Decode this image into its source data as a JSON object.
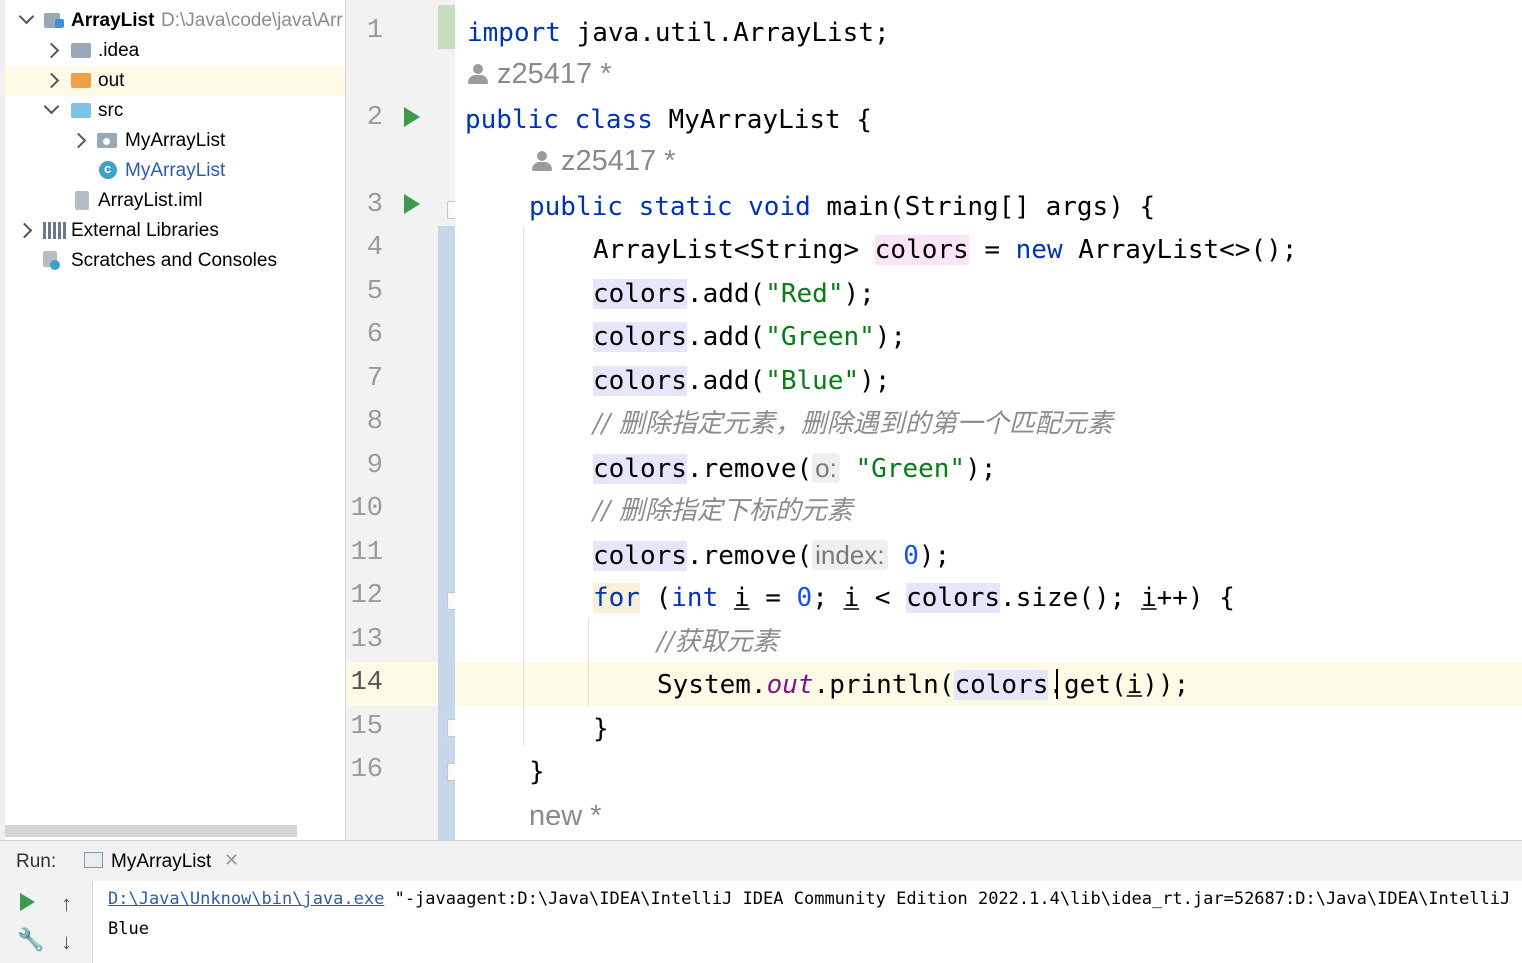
{
  "project_tree": {
    "root": {
      "name": "ArrayList",
      "path": "D:\\Java\\code\\java\\Arr"
    },
    "items": [
      {
        "label": ".idea"
      },
      {
        "label": "out"
      },
      {
        "label": "src"
      },
      {
        "label": "MyArrayList"
      },
      {
        "label": "MyArrayList"
      },
      {
        "label": "ArrayList.iml"
      },
      {
        "label": "External Libraries"
      },
      {
        "label": "Scratches and Consoles"
      }
    ]
  },
  "editor": {
    "author": "z25417 *",
    "author_new": "new *",
    "line_numbers": [
      "1",
      "2",
      "3",
      "4",
      "5",
      "6",
      "7",
      "8",
      "9",
      "10",
      "11",
      "12",
      "13",
      "14",
      "15",
      "16"
    ],
    "tok": {
      "import": "import",
      "import_path": " java.util.ArrayList;",
      "public": "public",
      "class": "class",
      "class_name": " MyArrayList {",
      "static": "static",
      "void": "void",
      "main_sig": " main(String[] args) {",
      "arraylist_type": "ArrayList<String> ",
      "colors": "colors",
      "eq": " = ",
      "new": "new",
      "new_rest": " ArrayList<>();",
      "dot_add": ".add(",
      "dot_remove": ".remove(",
      "close_semi": ");",
      "red": "\"Red\"",
      "green": "\"Green\"",
      "blue": "\"Blue\"",
      "comment1": "// 删除指定元素，删除遇到的第一个匹配元素",
      "hint_o": "o:",
      "comment2": "// 删除指定下标的元素",
      "hint_index": "index:",
      "zero": "0",
      "for": "for",
      "for_open": " (",
      "int": "int",
      "i": "i",
      "for_eq": " = ",
      "for_semi": "; ",
      "lt": " < ",
      "size_call": ".size(); ",
      "inc": "++) {",
      "comment3": "//获取元素",
      "system": "System.",
      "out": "out",
      "println": ".println(",
      "get_call": ".get(",
      "get_close": "));",
      "close_brace": "}"
    }
  },
  "run_panel": {
    "label": "Run:",
    "tab": "MyArrayList",
    "command_link": "D:\\Java\\Unknow\\bin\\java.exe",
    "command_rest": " \"-javaagent:D:\\Java\\IDEA\\IntelliJ IDEA Community Edition 2022.1.4\\lib\\idea_rt.jar=52687:D:\\Java\\IDEA\\IntelliJ IDEA",
    "output": "Blue"
  },
  "colors": {
    "keyword": "#0033b3",
    "string": "#067d17",
    "number": "#1750eb",
    "comment": "#8c8c8c",
    "static_field": "#871094",
    "current_line": "#fdfbe6",
    "run_icon": "#3d9a4d",
    "link": "#2a5db0"
  }
}
